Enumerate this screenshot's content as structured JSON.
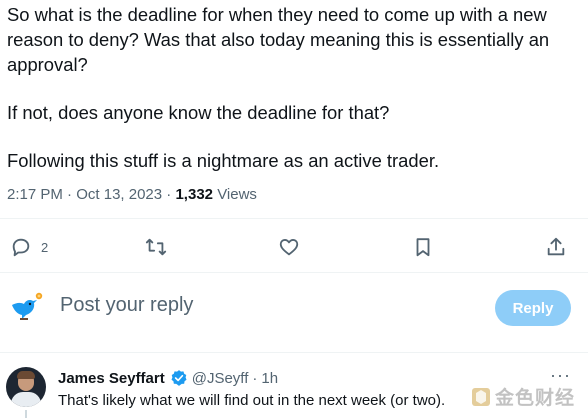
{
  "tweet": {
    "lines": [
      "So what is the deadline for when they need to come up with a new reason to deny?  Was that also today meaning this is essentially an approval?",
      "If not, does anyone know the deadline for that?",
      "Following this stuff is a nightmare as an active trader."
    ],
    "time": "2:17 PM",
    "separator": "·",
    "date": "Oct 13, 2023",
    "views_count": "1,332",
    "views_label": "Views"
  },
  "actions": {
    "reply_count": "2",
    "icons": [
      "reply-icon",
      "retweet-icon",
      "like-icon",
      "bookmark-icon",
      "share-icon"
    ]
  },
  "composer": {
    "placeholder": "Post your reply",
    "button_label": "Reply",
    "button_color": "#8ecdf8"
  },
  "reply": {
    "author_name": "James Seyffart",
    "handle": "@JSeyff",
    "separator": "·",
    "time": "1h",
    "text": "That's likely what we will find out in the next week (or two).",
    "more": "···"
  },
  "watermark": {
    "text": "金色财经"
  },
  "colors": {
    "accent": "#1d9bf0",
    "muted": "#536471",
    "text": "#0f1419"
  }
}
